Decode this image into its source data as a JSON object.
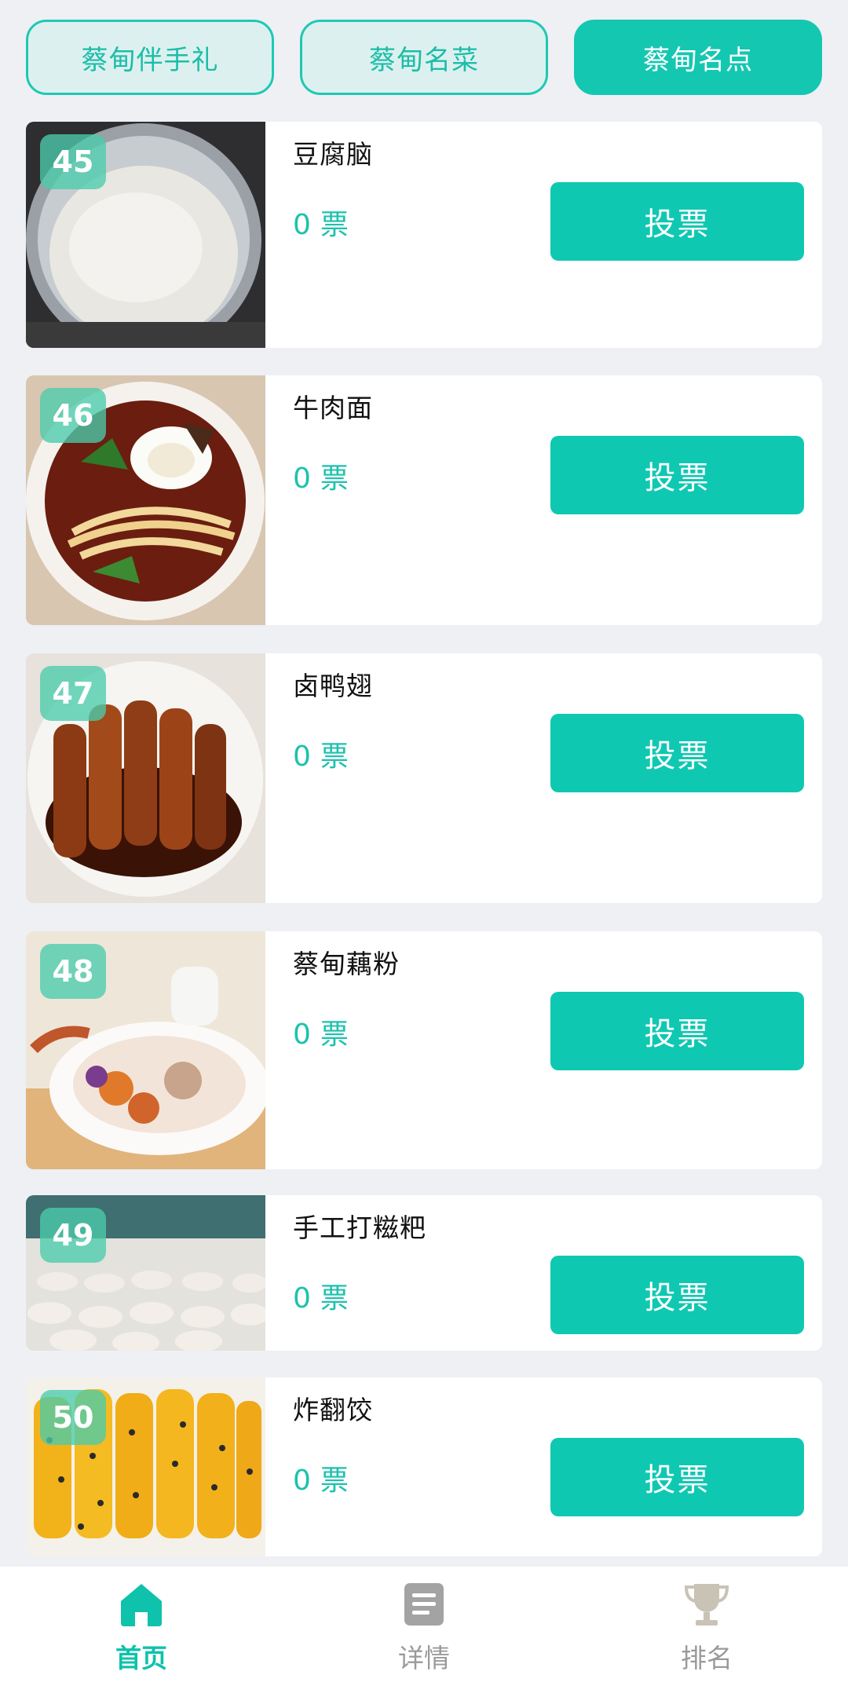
{
  "tabs": [
    {
      "label": "蔡甸伴手礼",
      "active": false
    },
    {
      "label": "蔡甸名菜",
      "active": false
    },
    {
      "label": "蔡甸名点",
      "active": true
    }
  ],
  "items": [
    {
      "rank": "45",
      "name": "豆腐脑",
      "votes": "0",
      "vote_unit": "票",
      "button": "投票"
    },
    {
      "rank": "46",
      "name": "牛肉面",
      "votes": "0",
      "vote_unit": "票",
      "button": "投票"
    },
    {
      "rank": "47",
      "name": "卤鸭翅",
      "votes": "0",
      "vote_unit": "票",
      "button": "投票"
    },
    {
      "rank": "48",
      "name": "蔡甸藕粉",
      "votes": "0",
      "vote_unit": "票",
      "button": "投票"
    },
    {
      "rank": "49",
      "name": "手工打糍粑",
      "votes": "0",
      "vote_unit": "票",
      "button": "投票"
    },
    {
      "rank": "50",
      "name": "炸翻饺",
      "votes": "0",
      "vote_unit": "票",
      "button": "投票"
    }
  ],
  "nav": [
    {
      "label": "首页",
      "icon": "home-icon",
      "active": true
    },
    {
      "label": "详情",
      "icon": "document-icon",
      "active": false
    },
    {
      "label": "排名",
      "icon": "trophy-icon",
      "active": false
    }
  ],
  "colors": {
    "accent": "#0fc8b2",
    "tab_inactive_bg": "#dcf1ef",
    "page_bg": "#eef0f4"
  }
}
